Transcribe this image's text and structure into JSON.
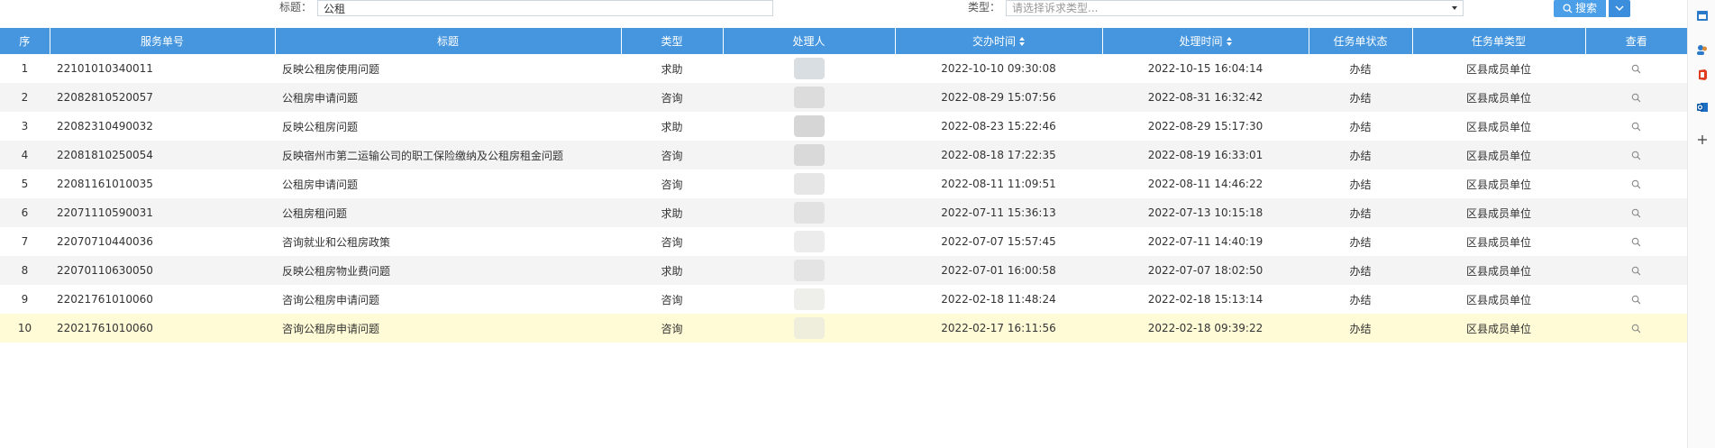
{
  "filters": {
    "title_label": "标题：",
    "title_value": "公租",
    "type_label": "类型：",
    "type_placeholder": "请选择诉求类型...",
    "search_label": "搜索"
  },
  "table": {
    "columns": [
      "序",
      "服务单号",
      "标题",
      "类型",
      "处理人",
      "交办时间",
      "处理时间",
      "任务单状态",
      "任务单类型",
      "查看"
    ],
    "rows": [
      {
        "idx": "1",
        "no": "22101010340011",
        "title": "反映公租房使用问题",
        "type": "求助",
        "handover": "2022-10-10 09:30:08",
        "handled": "2022-10-15 16:04:14",
        "status": "办结",
        "task_type": "区县成员单位"
      },
      {
        "idx": "2",
        "no": "22082810520057",
        "title": "公租房申请问题",
        "type": "咨询",
        "handover": "2022-08-29 15:07:56",
        "handled": "2022-08-31 16:32:42",
        "status": "办结",
        "task_type": "区县成员单位"
      },
      {
        "idx": "3",
        "no": "22082310490032",
        "title": "反映公租房问题",
        "type": "求助",
        "handover": "2022-08-23 15:22:46",
        "handled": "2022-08-29 15:17:30",
        "status": "办结",
        "task_type": "区县成员单位"
      },
      {
        "idx": "4",
        "no": "22081810250054",
        "title": "反映宿州市第二运输公司的职工保险缴纳及公租房租金问题",
        "type": "咨询",
        "handover": "2022-08-18 17:22:35",
        "handled": "2022-08-19 16:33:01",
        "status": "办结",
        "task_type": "区县成员单位"
      },
      {
        "idx": "5",
        "no": "22081161010035",
        "title": "公租房申请问题",
        "type": "咨询",
        "handover": "2022-08-11 11:09:51",
        "handled": "2022-08-11 14:46:22",
        "status": "办结",
        "task_type": "区县成员单位"
      },
      {
        "idx": "6",
        "no": "22071110590031",
        "title": "公租房租问题",
        "type": "求助",
        "handover": "2022-07-11 15:36:13",
        "handled": "2022-07-13 10:15:18",
        "status": "办结",
        "task_type": "区县成员单位"
      },
      {
        "idx": "7",
        "no": "22070710440036",
        "title": "咨询就业和公租房政策",
        "type": "咨询",
        "handover": "2022-07-07 15:57:45",
        "handled": "2022-07-11 14:40:19",
        "status": "办结",
        "task_type": "区县成员单位"
      },
      {
        "idx": "8",
        "no": "22070110630050",
        "title": "反映公租房物业费问题",
        "type": "求助",
        "handover": "2022-07-01 16:00:58",
        "handled": "2022-07-07 18:02:50",
        "status": "办结",
        "task_type": "区县成员单位"
      },
      {
        "idx": "9",
        "no": "22021761010060",
        "title": "咨询公租房申请问题",
        "type": "咨询",
        "handover": "2022-02-18 11:48:24",
        "handled": "2022-02-18 15:13:14",
        "status": "办结",
        "task_type": "区县成员单位"
      },
      {
        "idx": "10",
        "no": "22021761010060",
        "title": "咨询公租房申请问题",
        "type": "咨询",
        "handover": "2022-02-17 16:11:56",
        "handled": "2022-02-18 09:39:22",
        "status": "办结",
        "task_type": "区县成员单位"
      }
    ]
  },
  "colors": {
    "header_bg": "#4596de",
    "button_bg": "#4a9fe8",
    "selected_row_bg": "#fffbd6",
    "striped_row_bg": "#f4f4f4"
  },
  "edge_icons": [
    "calendar-app-icon",
    "contacts-app-icon",
    "office-app-icon",
    "outlook-app-icon",
    "plus-icon"
  ]
}
